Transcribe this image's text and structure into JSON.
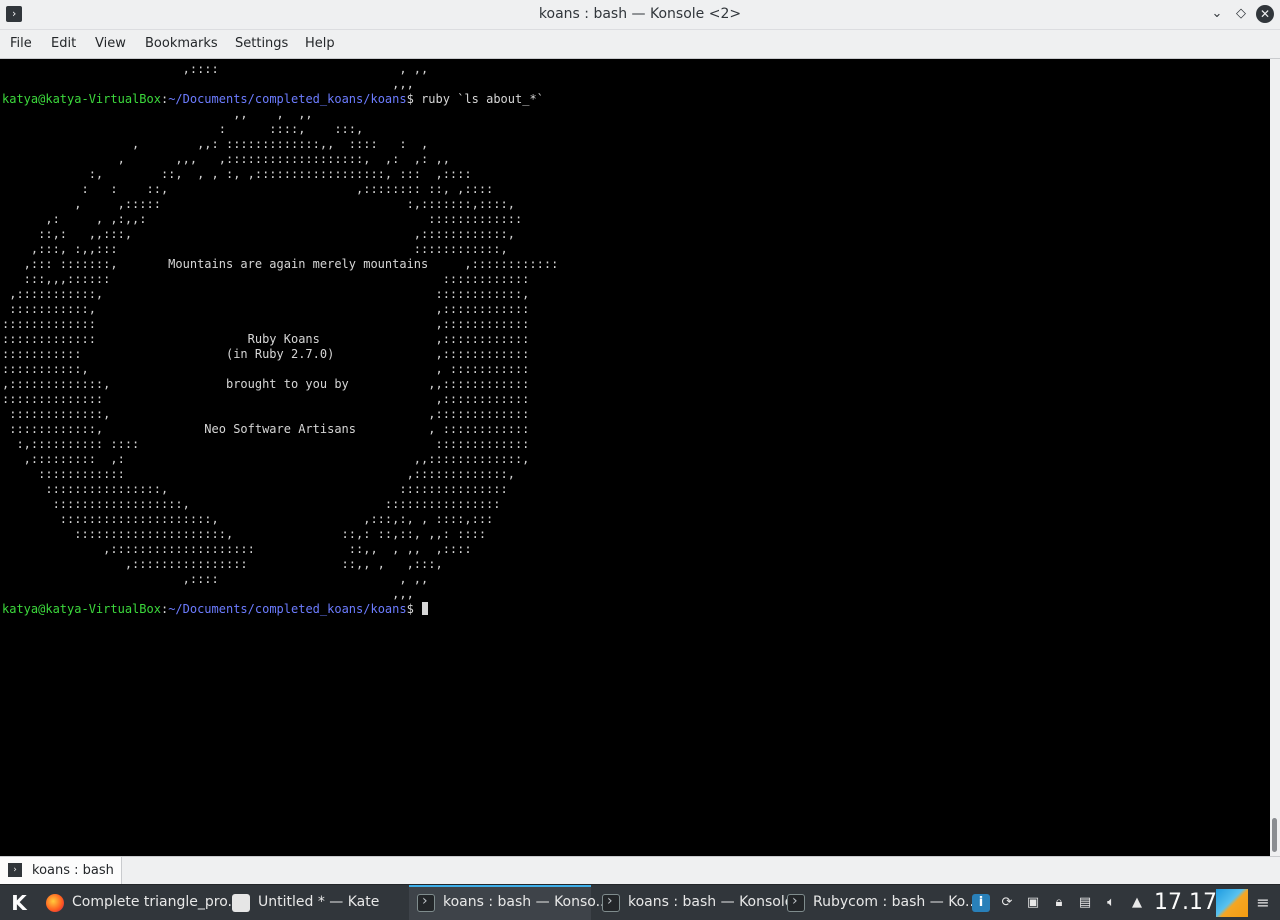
{
  "window": {
    "title": "koans : bash — Konsole <2>",
    "icon": "terminal-icon",
    "buttons": {
      "minimize": "chevron-down-icon",
      "maximize": "diamond-icon",
      "close": "close-icon"
    }
  },
  "menu": {
    "items": [
      "File",
      "Edit",
      "View",
      "Bookmarks",
      "Settings",
      "Help"
    ]
  },
  "terminal": {
    "prompt_user": "katya@katya-VirtualBox",
    "prompt_sep": ":",
    "prompt_path": "~/Documents/completed_koans/koans",
    "prompt_end": "$",
    "command": " ruby `ls about_*`",
    "top_lines": [
      "                         ,::::                         , ,,",
      "                                                      ,,,"
    ],
    "art_lines": [
      "                                ,,    ,  ,,",
      "                              :      ::::,    :::,",
      "                  ,        ,,: :::::::::::::,,  ::::   :  ,",
      "                ,       ,,,   ,:::::::::::::::::::,  ,:  ,: ,,",
      "            :,        ::,  , , :, ,::::::::::::::::::, :::  ,::::",
      "           :   :    ::,                          ,:::::::: ::, ,::::",
      "          ,     ,:::::                                  :,:::::::,::::,",
      "      ,:     , ,:,,:                                       :::::::::::::",
      "     ::,:   ,,:::,                                       ,::::::::::::,",
      "    ,:::, :,,:::                                         ::::::::::::,",
      "   ,::: :::::::,       Mountains are again merely mountains     ,::::::::::::",
      "   :::,,,::::::                                              ::::::::::::",
      " ,:::::::::::,                                              ::::::::::::,",
      " :::::::::::,                                               ,::::::::::::",
      ":::::::::::::                                               ,::::::::::::",
      ":::::::::::::                     Ruby Koans                ,::::::::::::",
      ":::::::::::                    (in Ruby 2.7.0)              ,::::::::::::",
      ":::::::::::,                                                , :::::::::::",
      ",:::::::::::::,                brought to you by           ,,::::::::::::",
      "::::::::::::::                                              ,::::::::::::",
      " :::::::::::::,                                            ,:::::::::::::",
      " ::::::::::::,              Neo Software Artisans          , ::::::::::::",
      "  :,:::::::::: ::::                                         :::::::::::::",
      "   ,:::::::::  ,:                                        ,,:::::::::::::,",
      "     ::::::::::::                                       ,:::::::::::::,",
      "      ::::::::::::::::,                                :::::::::::::::",
      "       ::::::::::::::::::,                           ::::::::::::::::",
      "        :::::::::::::::::::::,                    ,:::,:, , ::::,:::",
      "          :::::::::::::::::::::,               ::,: ::,::, ,,: ::::",
      "              ,::::::::::::::::::::             ::,,  , ,,  ,::::",
      "                 ,::::::::::::::::             ::,, ,   ,:::,",
      "                         ,::::                         , ,,",
      "                                                      ,,,"
    ]
  },
  "tab": {
    "label": "koans : bash",
    "icon": "terminal-icon"
  },
  "taskbar": {
    "start_icon": "kde-launcher-icon",
    "tasks": [
      {
        "label": "Complete triangle_pro...",
        "icon": "firefox-icon"
      },
      {
        "label": "Untitled * — Kate",
        "icon": "kate-document-icon"
      },
      {
        "label": "koans : bash — Konso...",
        "icon": "terminal-icon"
      },
      {
        "label": "koans : bash — Konsole",
        "icon": "terminal-icon"
      },
      {
        "label": "Rubycom : bash — Ko...",
        "icon": "terminal-icon"
      }
    ],
    "tray_icons": [
      "info-icon",
      "updates-icon",
      "clipboard-icon",
      "lock-icon",
      "battery-icon",
      "volume-icon",
      "expand-tray-icon"
    ],
    "clock": "17.17",
    "menu_icon": "hamburger-icon"
  }
}
